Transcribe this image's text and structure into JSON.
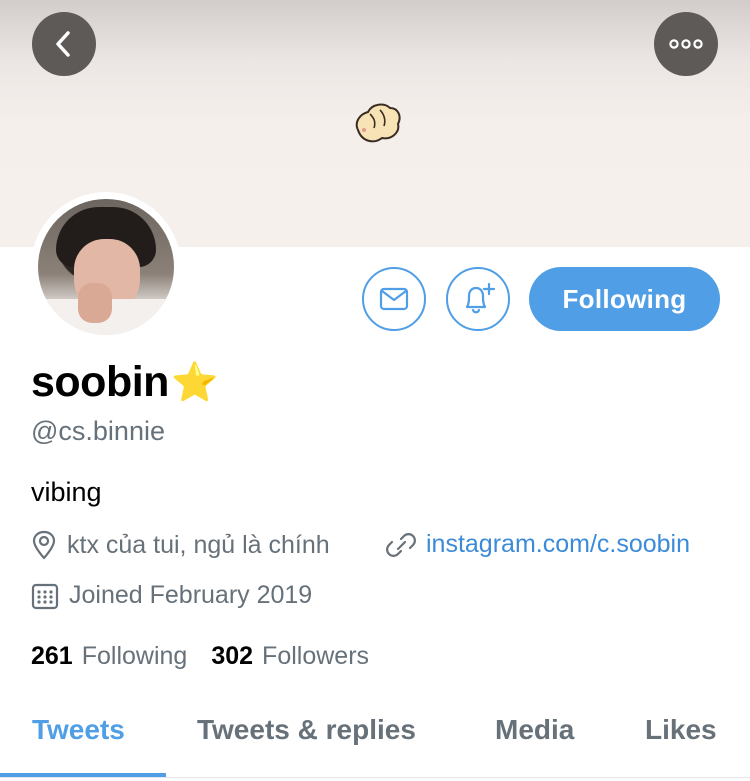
{
  "profile": {
    "display_name": "soobin",
    "name_emoji": "⭐",
    "handle": "@cs.binnie",
    "bio": "vibing",
    "location": "ktx của tui, ngủ là chính",
    "website": "instagram.com/c.soobin",
    "joined": "Joined February 2019"
  },
  "actions": {
    "following_label": "Following"
  },
  "stats": {
    "following_count": "261",
    "following_label": "Following",
    "followers_count": "302",
    "followers_label": "Followers"
  },
  "tabs": [
    {
      "label": "Tweets",
      "active": true
    },
    {
      "label": "Tweets & replies",
      "active": false
    },
    {
      "label": "Media",
      "active": false
    },
    {
      "label": "Likes",
      "active": false
    }
  ],
  "icons": {
    "back": "chevron-left-icon",
    "more": "more-dots-icon",
    "message": "envelope-icon",
    "notify": "bell-plus-icon",
    "location": "map-pin-icon",
    "website": "link-icon",
    "joined": "calendar-icon"
  },
  "colors": {
    "accent": "#4f9ee6",
    "secondary_text": "#67717a",
    "link": "#3b8bd8",
    "banner": "#f6f0ed"
  }
}
